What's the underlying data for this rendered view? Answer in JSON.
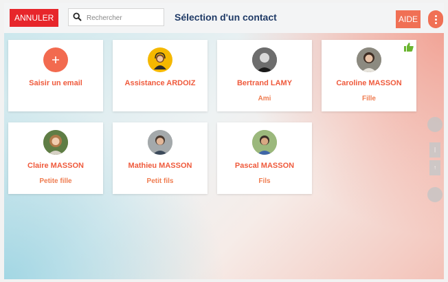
{
  "header": {
    "cancel_label": "ANNULER",
    "search_placeholder": "Rechercher",
    "title": "Sélection d'un contact",
    "help_label": "AIDE"
  },
  "colors": {
    "cancel": "#e7262b",
    "accent": "#f07055",
    "name_text": "#ef5a3c",
    "title_text": "#1f3a66"
  },
  "contacts": [
    {
      "name": "Saisir un email",
      "relation": "",
      "icon": "plus-icon"
    },
    {
      "name": "Assistance ARDOIZ",
      "relation": "",
      "icon": "support-avatar"
    },
    {
      "name": "Bertrand LAMY",
      "relation": "Ami",
      "icon": "avatar-photo"
    },
    {
      "name": "Caroline MASSON",
      "relation": "Fille",
      "icon": "avatar-photo",
      "badge": "thumbs-up-icon"
    },
    {
      "name": "Claire MASSON",
      "relation": "Petite fille",
      "icon": "avatar-photo"
    },
    {
      "name": "Mathieu MASSON",
      "relation": "Petit fils",
      "icon": "avatar-photo"
    },
    {
      "name": "Pascal MASSON",
      "relation": "Fils",
      "icon": "avatar-photo"
    }
  ]
}
